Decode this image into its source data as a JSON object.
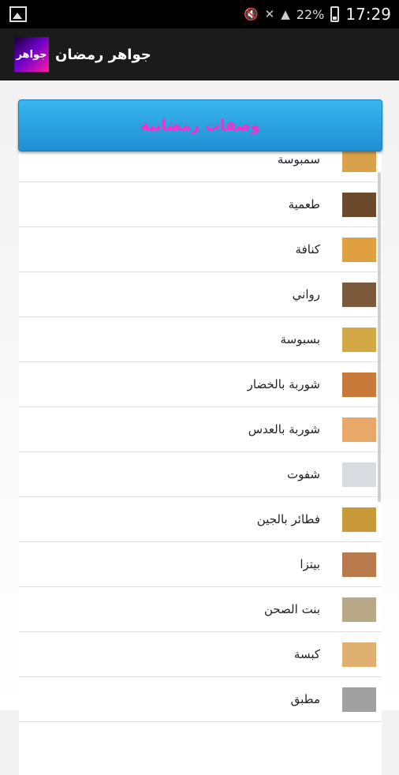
{
  "status_bar": {
    "battery": "22%",
    "time": "17:29",
    "icons": [
      "gallery-icon",
      "mute-icon",
      "wifi-off-icon",
      "signal-icon",
      "battery-icon"
    ]
  },
  "app_bar": {
    "logo_text": "جواهر",
    "title": "جواهر رمضان"
  },
  "header": {
    "label": "وصفات رمضانية"
  },
  "recipes": [
    {
      "label": "سمبوسة",
      "thumb_color": "#d9a24a"
    },
    {
      "label": "طعمية",
      "thumb_color": "#6b4a2b"
    },
    {
      "label": "كنافة",
      "thumb_color": "#e0a040"
    },
    {
      "label": "رواني",
      "thumb_color": "#7a5a3a"
    },
    {
      "label": "بسبوسة",
      "thumb_color": "#d4a845"
    },
    {
      "label": "شوربة بالخضار",
      "thumb_color": "#c87a3a"
    },
    {
      "label": "شوربة بالعدس",
      "thumb_color": "#e8a868"
    },
    {
      "label": "شفوت",
      "thumb_color": "#d8dce0"
    },
    {
      "label": "فطائر بالجين",
      "thumb_color": "#c89a3a"
    },
    {
      "label": "بيتزا",
      "thumb_color": "#b87a4a"
    },
    {
      "label": "بنت الصحن",
      "thumb_color": "#b8a888"
    },
    {
      "label": "كبسة",
      "thumb_color": "#e0b070"
    },
    {
      "label": "مطبق",
      "thumb_color": "#a0a0a0"
    }
  ]
}
